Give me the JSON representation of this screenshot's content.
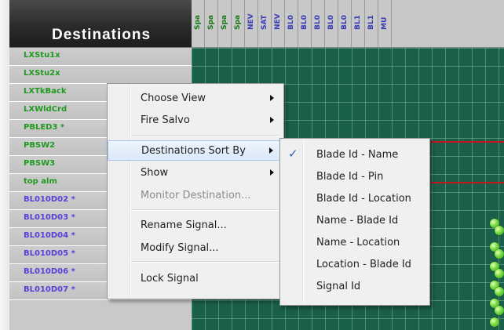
{
  "header": {
    "title": "Destinations"
  },
  "column_headers": [
    {
      "label": "Spa",
      "color": "#1a7a1a"
    },
    {
      "label": "Spa",
      "color": "#1a7a1a"
    },
    {
      "label": "Spa",
      "color": "#1a7a1a"
    },
    {
      "label": "Spa",
      "color": "#1a7a1a"
    },
    {
      "label": "NEV",
      "color": "#3b3bb8"
    },
    {
      "label": "SAT",
      "color": "#3b3bb8"
    },
    {
      "label": "NEV",
      "color": "#3b3bb8"
    },
    {
      "label": "BL0",
      "color": "#3b3bb8"
    },
    {
      "label": "BL0",
      "color": "#3b3bb8"
    },
    {
      "label": "BL0",
      "color": "#3b3bb8"
    },
    {
      "label": "BL0",
      "color": "#3b3bb8"
    },
    {
      "label": "BL0",
      "color": "#3b3bb8"
    },
    {
      "label": "BL1",
      "color": "#3b3bb8"
    },
    {
      "label": "BL1",
      "color": "#3b3bb8"
    },
    {
      "label": "MU",
      "color": "#3b3bb8"
    }
  ],
  "destinations": [
    {
      "label": "LXStu1x",
      "color": "#1f9a1f"
    },
    {
      "label": "LXStu2x",
      "color": "#1f9a1f"
    },
    {
      "label": "LXTkBack",
      "color": "#1f9a1f"
    },
    {
      "label": "LXWldCrd",
      "color": "#1f9a1f"
    },
    {
      "label": "PBLED3 *",
      "color": "#1f9a1f"
    },
    {
      "label": "PBSW2",
      "color": "#1f9a1f"
    },
    {
      "label": "PBSW3",
      "color": "#1f9a1f"
    },
    {
      "label": "top alm",
      "color": "#1f9a1f"
    },
    {
      "label": "BL010D02 *",
      "color": "#5a3ed8"
    },
    {
      "label": "BL010D03 *",
      "color": "#5a3ed8"
    },
    {
      "label": "BL010D04 *",
      "color": "#5a3ed8"
    },
    {
      "label": "BL010D05 *",
      "color": "#5a3ed8"
    },
    {
      "label": "BL010D06 *",
      "color": "#5a3ed8"
    },
    {
      "label": "BL010D07 *",
      "color": "#5a3ed8"
    }
  ],
  "context_menu": {
    "items": [
      {
        "label": "Choose View",
        "submenu": true,
        "disabled": false
      },
      {
        "label": "Fire Salvo",
        "submenu": true,
        "disabled": false
      },
      {
        "label": "Destinations Sort By",
        "submenu": true,
        "disabled": false,
        "highlighted": true
      },
      {
        "label": "Show",
        "submenu": true,
        "disabled": false
      },
      {
        "label": "Monitor Destination...",
        "submenu": false,
        "disabled": true
      },
      {
        "label": "Rename Signal...",
        "submenu": false,
        "disabled": false
      },
      {
        "label": "Modify Signal...",
        "submenu": false,
        "disabled": false
      },
      {
        "label": "Lock Signal",
        "submenu": false,
        "disabled": false
      }
    ]
  },
  "sort_submenu": {
    "items": [
      {
        "label": "Blade Id - Name",
        "checked": true
      },
      {
        "label": "Blade Id - Pin",
        "checked": false
      },
      {
        "label": "Blade Id - Location",
        "checked": false
      },
      {
        "label": "Name - Blade Id",
        "checked": false
      },
      {
        "label": "Name - Location",
        "checked": false
      },
      {
        "label": "Location - Blade Id",
        "checked": false
      },
      {
        "label": "Signal Id",
        "checked": false
      }
    ],
    "check_glyph": "✓"
  },
  "colors": {
    "grid_bg": "#1a5f47",
    "route_line": "#c8141e",
    "crosspoint": "#7fe04a"
  },
  "icons": {
    "submenu_arrow": "chevron-right-icon",
    "crosspoint": "crosspoint-dot-icon"
  }
}
